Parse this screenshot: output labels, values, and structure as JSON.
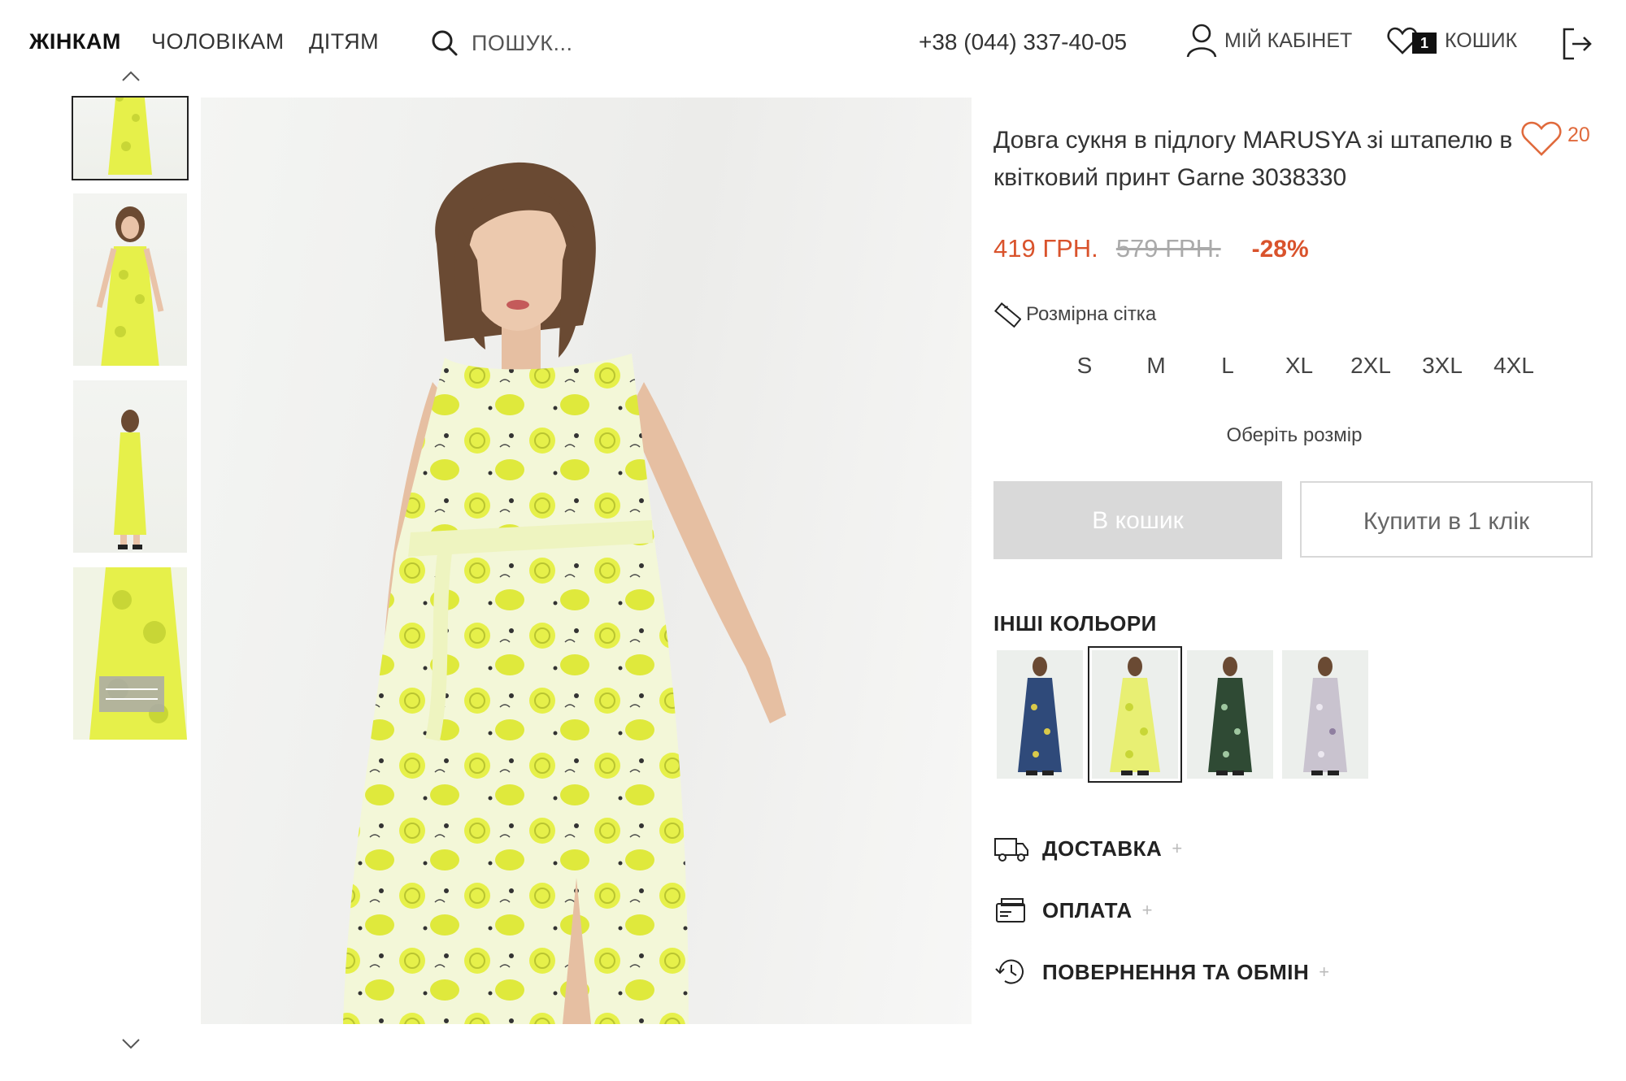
{
  "header": {
    "nav": [
      {
        "label": "ЖІНКАМ",
        "active": true
      },
      {
        "label": "ЧОЛОВІКАМ",
        "active": false
      },
      {
        "label": "ДІТЯМ",
        "active": false
      }
    ],
    "search_placeholder": "ПОШУК...",
    "phone": "+38 (044) 337-40-05",
    "account_label": "МІЙ КАБІНЕТ",
    "cart_label": "КОШИК",
    "cart_count": "1"
  },
  "gallery": {
    "thumbs": [
      "model-front-full",
      "model-front-close",
      "model-back",
      "dress-detail"
    ],
    "active_index": 0
  },
  "product": {
    "title": "Довга сукня в підлогу MARUSYA зі штапелю в квітковий принт Garne 3038330",
    "wishlist_count": "20",
    "price_new": "419 ГРН.",
    "price_old": "579 ГРН.",
    "discount": "-28%",
    "size_chart_label": "Розмірна сітка",
    "sizes": [
      "S",
      "M",
      "L",
      "XL",
      "2XL",
      "3XL",
      "4XL"
    ],
    "size_hint": "Оберіть розмір",
    "add_to_cart": "В кошик",
    "buy_one_click": "Купити в 1 клік",
    "other_colors_label": "ІНШІ КОЛЬОРИ",
    "other_colors": [
      {
        "name": "blue floral",
        "color": "#2f4a7a",
        "accent": "#d9c94a"
      },
      {
        "name": "yellow lemon",
        "color": "#e8ef73",
        "accent": "#f4f6e8"
      },
      {
        "name": "green floral",
        "color": "#2f4a34",
        "accent": "#9fc7a0"
      },
      {
        "name": "grey floral",
        "color": "#c9c3cf",
        "accent": "#ece8f0"
      }
    ],
    "active_color_index": 1,
    "accordions": [
      {
        "label": "ДОСТАВКА",
        "icon": "truck-icon"
      },
      {
        "label": "ОПЛАТА",
        "icon": "wallet-icon"
      },
      {
        "label": "ПОВЕРНЕННЯ ТА ОБМІН",
        "icon": "return-clock-icon"
      }
    ]
  },
  "colors": {
    "accent": "#d9532c",
    "wishlist": "#e06a3c",
    "dress": "#e6f04a"
  }
}
